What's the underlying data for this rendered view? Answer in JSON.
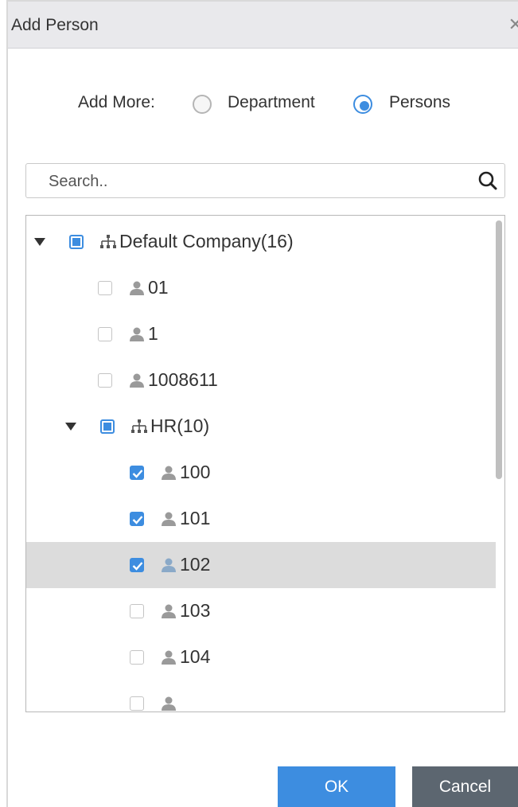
{
  "dialog": {
    "title": "Add Person",
    "close_glyph": "✕"
  },
  "add_more": {
    "label": "Add More:",
    "options": [
      {
        "label": "Department",
        "selected": false
      },
      {
        "label": "Persons",
        "selected": true
      }
    ]
  },
  "search": {
    "placeholder": "Search..",
    "value": "",
    "icon": "search-icon"
  },
  "tree": {
    "nodes": [
      {
        "label": "Default Company(16)",
        "type": "org",
        "level": 0,
        "expanded": true,
        "check": "partial"
      },
      {
        "label": "01",
        "type": "person",
        "level": 1,
        "check": "unchecked"
      },
      {
        "label": "1",
        "type": "person",
        "level": 1,
        "check": "unchecked"
      },
      {
        "label": "1008611",
        "type": "person",
        "level": 1,
        "check": "unchecked"
      },
      {
        "label": "HR(10)",
        "type": "org",
        "level": 1,
        "expanded": true,
        "check": "partial"
      },
      {
        "label": "100",
        "type": "person",
        "level": 2,
        "check": "checked"
      },
      {
        "label": "101",
        "type": "person",
        "level": 2,
        "check": "checked"
      },
      {
        "label": "102",
        "type": "person",
        "level": 2,
        "check": "checked",
        "selected": true
      },
      {
        "label": "103",
        "type": "person",
        "level": 2,
        "check": "unchecked"
      },
      {
        "label": "104",
        "type": "person",
        "level": 2,
        "check": "unchecked"
      },
      {
        "label": "",
        "type": "person",
        "level": 2,
        "check": "unchecked"
      }
    ]
  },
  "buttons": {
    "ok": "OK",
    "cancel": "Cancel"
  },
  "colors": {
    "accent": "#3d8de0",
    "selected_row": "#dcdcdc",
    "cancel_bg": "#5c6670"
  }
}
